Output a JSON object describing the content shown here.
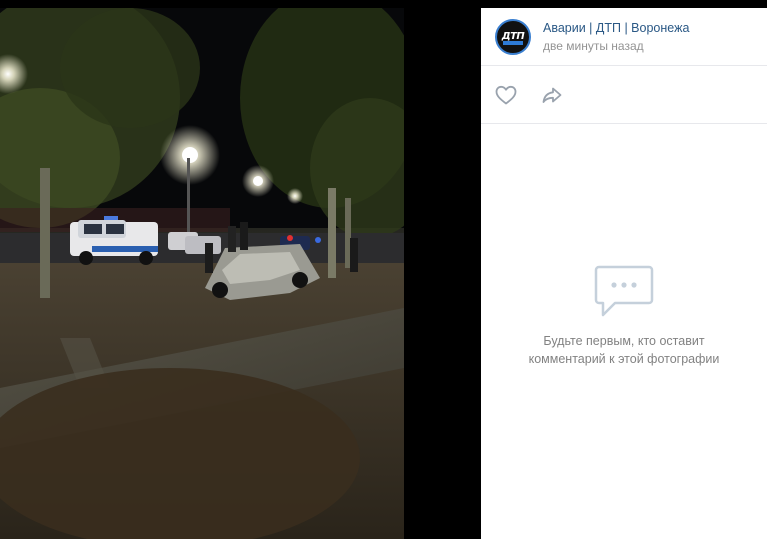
{
  "post": {
    "author": "Аварии | ДТП | Воронежа",
    "time": "две минуты назад",
    "avatar_icon": "community-logo-icon",
    "avatar_text": "ДТП"
  },
  "actions": {
    "like_icon": "heart-icon",
    "share_icon": "share-arrow-icon"
  },
  "comments": {
    "empty_icon": "comment-bubble-icon",
    "empty_line1": "Будьте первым, кто оставит",
    "empty_line2": "комментарий к этой фотографии"
  },
  "colors": {
    "author_link": "#2a5885",
    "muted_text": "#939393",
    "divider": "#e7e8ec",
    "icon_gray": "#99a2ad",
    "empty_icon": "#c5d0db"
  }
}
